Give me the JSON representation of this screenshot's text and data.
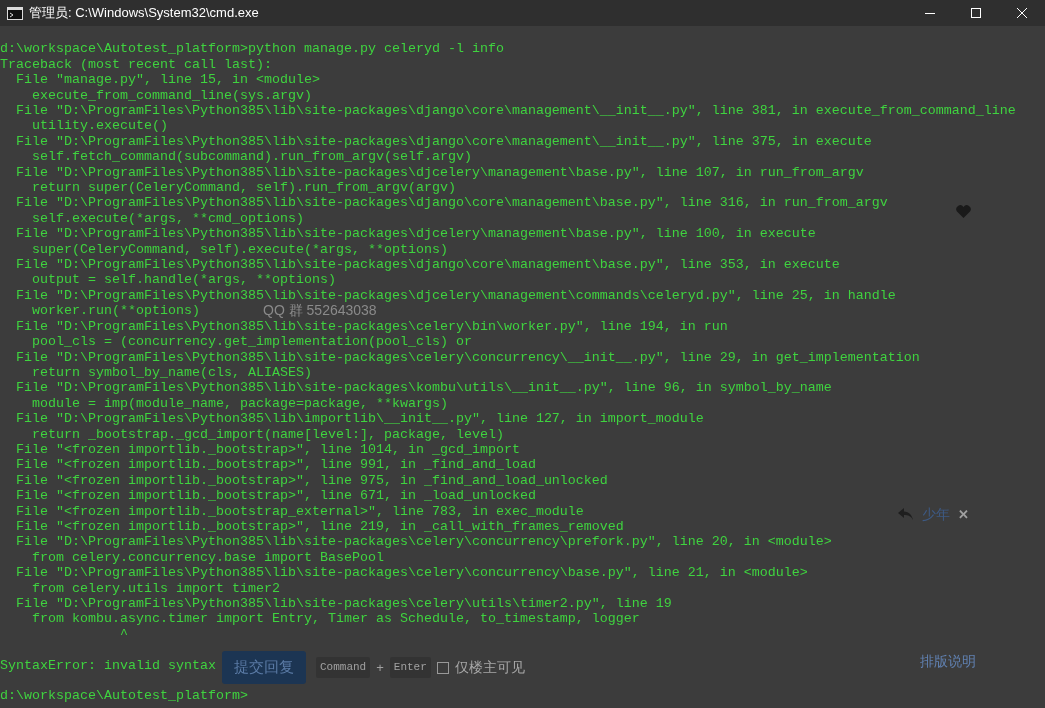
{
  "window": {
    "title": "管理员: C:\\Windows\\System32\\cmd.exe"
  },
  "console": {
    "lines": [
      {
        "text": "d:\\workspace\\Autotest_platform>python manage.py celeryd -l info",
        "space_before": true
      },
      {
        "text": "Traceback (most recent call last):",
        "space_before": false
      },
      {
        "text": "  File \"manage.py\", line 15, in <module>",
        "space_before": false
      },
      {
        "text": "    execute_from_command_line(sys.argv)",
        "space_before": false
      },
      {
        "text": "  File \"D:\\ProgramFiles\\Python385\\lib\\site-packages\\django\\core\\management\\__init__.py\", line 381, in execute_from_command_line",
        "space_before": false
      },
      {
        "text": "    utility.execute()",
        "space_before": false
      },
      {
        "text": "  File \"D:\\ProgramFiles\\Python385\\lib\\site-packages\\django\\core\\management\\__init__.py\", line 375, in execute",
        "space_before": false
      },
      {
        "text": "    self.fetch_command(subcommand).run_from_argv(self.argv)",
        "space_before": false
      },
      {
        "text": "  File \"D:\\ProgramFiles\\Python385\\lib\\site-packages\\djcelery\\management\\base.py\", line 107, in run_from_argv",
        "space_before": false
      },
      {
        "text": "    return super(CeleryCommand, self).run_from_argv(argv)",
        "space_before": false
      },
      {
        "text": "  File \"D:\\ProgramFiles\\Python385\\lib\\site-packages\\django\\core\\management\\base.py\", line 316, in run_from_argv",
        "space_before": false
      },
      {
        "text": "    self.execute(*args, **cmd_options)",
        "space_before": false
      },
      {
        "text": "  File \"D:\\ProgramFiles\\Python385\\lib\\site-packages\\djcelery\\management\\base.py\", line 100, in execute",
        "space_before": false
      },
      {
        "text": "    super(CeleryCommand, self).execute(*args, **options)",
        "space_before": false
      },
      {
        "text": "  File \"D:\\ProgramFiles\\Python385\\lib\\site-packages\\django\\core\\management\\base.py\", line 353, in execute",
        "space_before": false
      },
      {
        "text": "    output = self.handle(*args, **options)",
        "space_before": false
      },
      {
        "text": "  File \"D:\\ProgramFiles\\Python385\\lib\\site-packages\\djcelery\\management\\commands\\celeryd.py\", line 25, in handle",
        "space_before": false
      },
      {
        "text": "    worker.run(**options)",
        "space_before": false
      },
      {
        "text": "  File \"D:\\ProgramFiles\\Python385\\lib\\site-packages\\celery\\bin\\worker.py\", line 194, in run",
        "space_before": false
      },
      {
        "text": "    pool_cls = (concurrency.get_implementation(pool_cls) or",
        "space_before": false
      },
      {
        "text": "  File \"D:\\ProgramFiles\\Python385\\lib\\site-packages\\celery\\concurrency\\__init__.py\", line 29, in get_implementation",
        "space_before": false
      },
      {
        "text": "    return symbol_by_name(cls, ALIASES)",
        "space_before": false
      },
      {
        "text": "  File \"D:\\ProgramFiles\\Python385\\lib\\site-packages\\kombu\\utils\\__init__.py\", line 96, in symbol_by_name",
        "space_before": false
      },
      {
        "text": "    module = imp(module_name, package=package, **kwargs)",
        "space_before": false
      },
      {
        "text": "  File \"D:\\ProgramFiles\\Python385\\lib\\importlib\\__init__.py\", line 127, in import_module",
        "space_before": false
      },
      {
        "text": "    return _bootstrap._gcd_import(name[level:], package, level)",
        "space_before": false
      },
      {
        "text": "  File \"<frozen importlib._bootstrap>\", line 1014, in _gcd_import",
        "space_before": false
      },
      {
        "text": "  File \"<frozen importlib._bootstrap>\", line 991, in _find_and_load",
        "space_before": false
      },
      {
        "text": "  File \"<frozen importlib._bootstrap>\", line 975, in _find_and_load_unlocked",
        "space_before": false
      },
      {
        "text": "  File \"<frozen importlib._bootstrap>\", line 671, in _load_unlocked",
        "space_before": false
      },
      {
        "text": "  File \"<frozen importlib._bootstrap_external>\", line 783, in exec_module",
        "space_before": false
      },
      {
        "text": "  File \"<frozen importlib._bootstrap>\", line 219, in _call_with_frames_removed",
        "space_before": false
      },
      {
        "text": "  File \"D:\\ProgramFiles\\Python385\\lib\\site-packages\\celery\\concurrency\\prefork.py\", line 20, in <module>",
        "space_before": false
      },
      {
        "text": "    from celery.concurrency.base import BasePool",
        "space_before": false
      },
      {
        "text": "  File \"D:\\ProgramFiles\\Python385\\lib\\site-packages\\celery\\concurrency\\base.py\", line 21, in <module>",
        "space_before": false
      },
      {
        "text": "    from celery.utils import timer2",
        "space_before": false
      },
      {
        "text": "  File \"D:\\ProgramFiles\\Python385\\lib\\site-packages\\celery\\utils\\timer2.py\", line 19",
        "space_before": false
      },
      {
        "text": "    from kombu.async.timer import Entry, Timer as Schedule, to_timestamp, logger",
        "space_before": false
      },
      {
        "text": "               ^",
        "space_before": false
      },
      {
        "text": "SyntaxError: invalid syntax",
        "space_before": true
      },
      {
        "text": "d:\\workspace\\Autotest_platform>",
        "space_before": true
      }
    ]
  },
  "background_page": {
    "qq_group": "QQ 群 552643038",
    "reply_to": {
      "name": "少年",
      "close": "✕"
    },
    "submit_button": "提交回复",
    "shortcut": [
      "Command",
      "+",
      "Enter"
    ],
    "owner_only": {
      "label": "仅楼主可见",
      "checked": false
    },
    "format_help": "排版说明"
  }
}
